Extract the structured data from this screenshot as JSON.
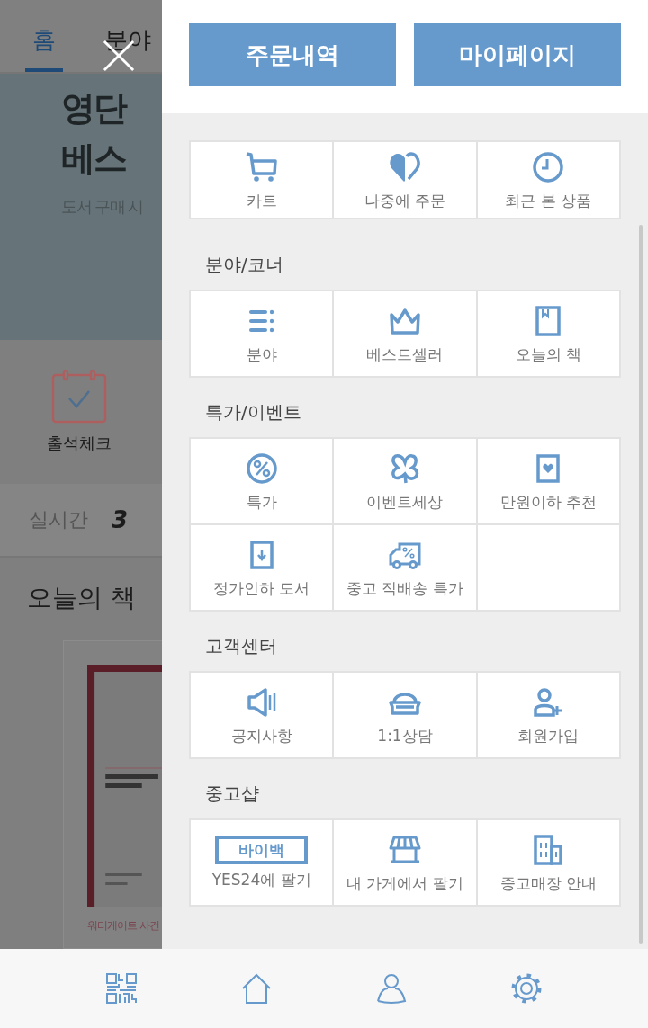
{
  "background_page": {
    "tabs": [
      {
        "label": "홈",
        "selected": true
      },
      {
        "label": "분야",
        "selected": false
      }
    ],
    "banner": {
      "title_lines": [
        "영단",
        "베스"
      ],
      "subtitle": "도서 구매 시"
    },
    "attendance": {
      "label": "출석체크"
    },
    "realtime": {
      "label": "실시간",
      "rank": "3"
    },
    "todays_book": {
      "heading": "오늘의 책",
      "book_title": "워터게이트 사건"
    }
  },
  "menu": {
    "top_buttons": [
      "주문내역",
      "마이페이지"
    ],
    "quick_items": [
      {
        "kind": "cart",
        "label": "카트"
      },
      {
        "kind": "heart",
        "label": "나중에 주문"
      },
      {
        "kind": "clock",
        "label": "최근 본 상품"
      }
    ],
    "sections": [
      {
        "title": "분야/코너",
        "items": [
          {
            "kind": "list",
            "label": "분야"
          },
          {
            "kind": "crown",
            "label": "베스트셀러"
          },
          {
            "kind": "book",
            "label": "오늘의 책"
          }
        ]
      },
      {
        "title": "특가/이벤트",
        "items": [
          {
            "kind": "percent",
            "label": "특가"
          },
          {
            "kind": "clover",
            "label": "이벤트세상"
          },
          {
            "kind": "heartbox",
            "label": "만원이하 추천"
          },
          {
            "kind": "downbox",
            "label": "정가인하 도서"
          },
          {
            "kind": "truck",
            "label": "중고 직배송 특가"
          }
        ]
      },
      {
        "title": "고객센터",
        "items": [
          {
            "kind": "speaker",
            "label": "공지사항"
          },
          {
            "kind": "sofa",
            "label": "1:1상담"
          },
          {
            "kind": "useradd",
            "label": "회원가입"
          }
        ]
      },
      {
        "title": "중고샵",
        "items": [
          {
            "kind": "buyback",
            "badge": "바이백",
            "label": "YES24에 팔기"
          },
          {
            "kind": "store",
            "label": "내 가게에서 팔기"
          },
          {
            "kind": "building",
            "label": "중고매장 안내"
          }
        ]
      }
    ]
  },
  "bottom_bar": {
    "items": [
      {
        "kind": "qr"
      },
      {
        "kind": "home"
      },
      {
        "kind": "user"
      },
      {
        "kind": "settings"
      }
    ]
  }
}
